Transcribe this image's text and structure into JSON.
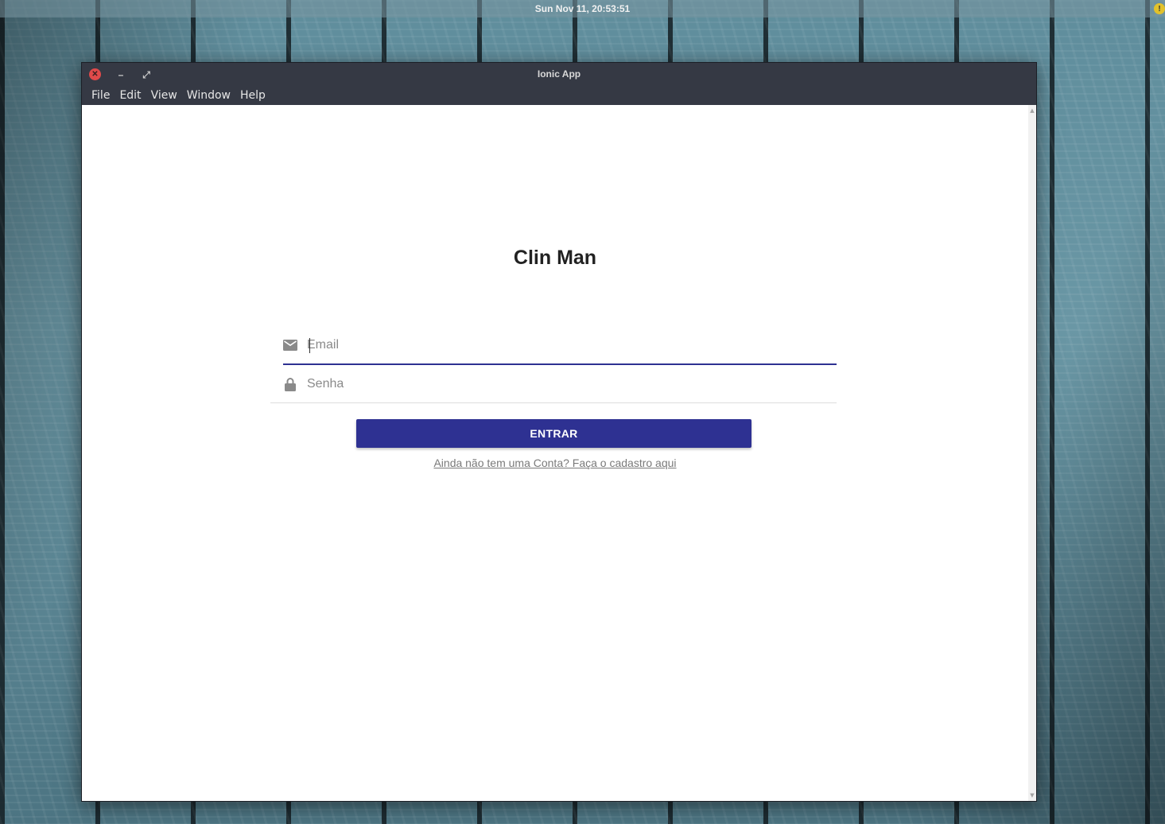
{
  "top_panel": {
    "clock": "Sun Nov 11, 20:53:51",
    "alert_glyph": "!"
  },
  "window": {
    "title": "Ionic App",
    "controls": {
      "close_glyph": "✕",
      "minimize_glyph": "–",
      "maximize_glyph": "⤢"
    }
  },
  "menubar": {
    "items": [
      {
        "label": "File"
      },
      {
        "label": "Edit"
      },
      {
        "label": "View"
      },
      {
        "label": "Window"
      },
      {
        "label": "Help"
      }
    ]
  },
  "login": {
    "app_title": "Clin Man",
    "email_placeholder": "Email",
    "email_value": "",
    "password_placeholder": "Senha",
    "password_value": "",
    "submit_label": "ENTRAR",
    "signup_link": "Ainda não tem uma Conta? Faça o cadastro aqui"
  },
  "colors": {
    "primary": "#2e3192",
    "titlebar": "#353944",
    "close_button": "#e04a4a"
  },
  "icons": {
    "email": "mail-icon",
    "password": "lock-icon"
  }
}
